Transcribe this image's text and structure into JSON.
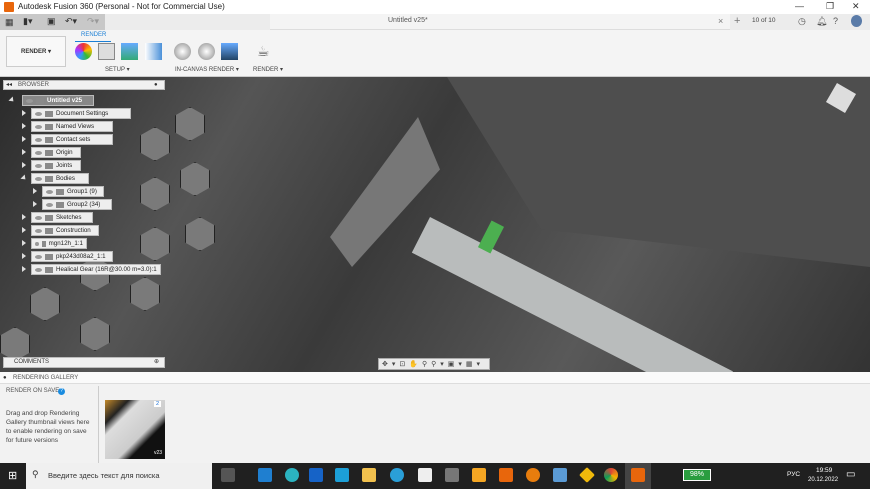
{
  "window": {
    "title": "Autodesk Fusion 360 (Personal - Not for Commercial Use)",
    "minimize": "—",
    "restore": "❐",
    "close": "✕"
  },
  "doc_tab": {
    "title": "Untitled v25*",
    "close": "×",
    "jobs": "10 of 10"
  },
  "ribbon": {
    "active_tab": "RENDER",
    "workspace": "RENDER ▾",
    "groups": [
      "SETUP ▾",
      "IN-CANVAS RENDER ▾",
      "RENDER ▾"
    ]
  },
  "browser": {
    "title": "BROWSER",
    "items": [
      {
        "label": "Untitled v25",
        "level": 0,
        "expanded": true
      },
      {
        "label": "Document Settings",
        "level": 1
      },
      {
        "label": "Named Views",
        "level": 1
      },
      {
        "label": "Contact sets",
        "level": 1
      },
      {
        "label": "Origin",
        "level": 1
      },
      {
        "label": "Joints",
        "level": 1
      },
      {
        "label": "Bodies",
        "level": 1,
        "expanded": true
      },
      {
        "label": "Group1 (9)",
        "level": 2
      },
      {
        "label": "Group2 (34)",
        "level": 2
      },
      {
        "label": "Sketches",
        "level": 1
      },
      {
        "label": "Construction",
        "level": 1
      },
      {
        "label": "mgn12h_1:1",
        "level": 1
      },
      {
        "label": "pkp243d08a2_1:1",
        "level": 1
      },
      {
        "label": "Healical Gear (16R@30.00 m=3.0):1",
        "level": 1
      }
    ]
  },
  "comments": {
    "title": "COMMENTS"
  },
  "gallery": {
    "title": "RENDERING GALLERY",
    "render_on_save": "RENDER ON SAVE",
    "help": "?",
    "hint": "Drag and drop Rendering Gallery thumbnail views here to enable rendering on save for future versions",
    "thumb_count": "2",
    "thumb_version": "v23"
  },
  "taskbar": {
    "search_placeholder": "Введите здесь текст для поиска",
    "battery": "98%",
    "lang": "РУС",
    "time": "19:59",
    "date": "20.12.2022"
  }
}
